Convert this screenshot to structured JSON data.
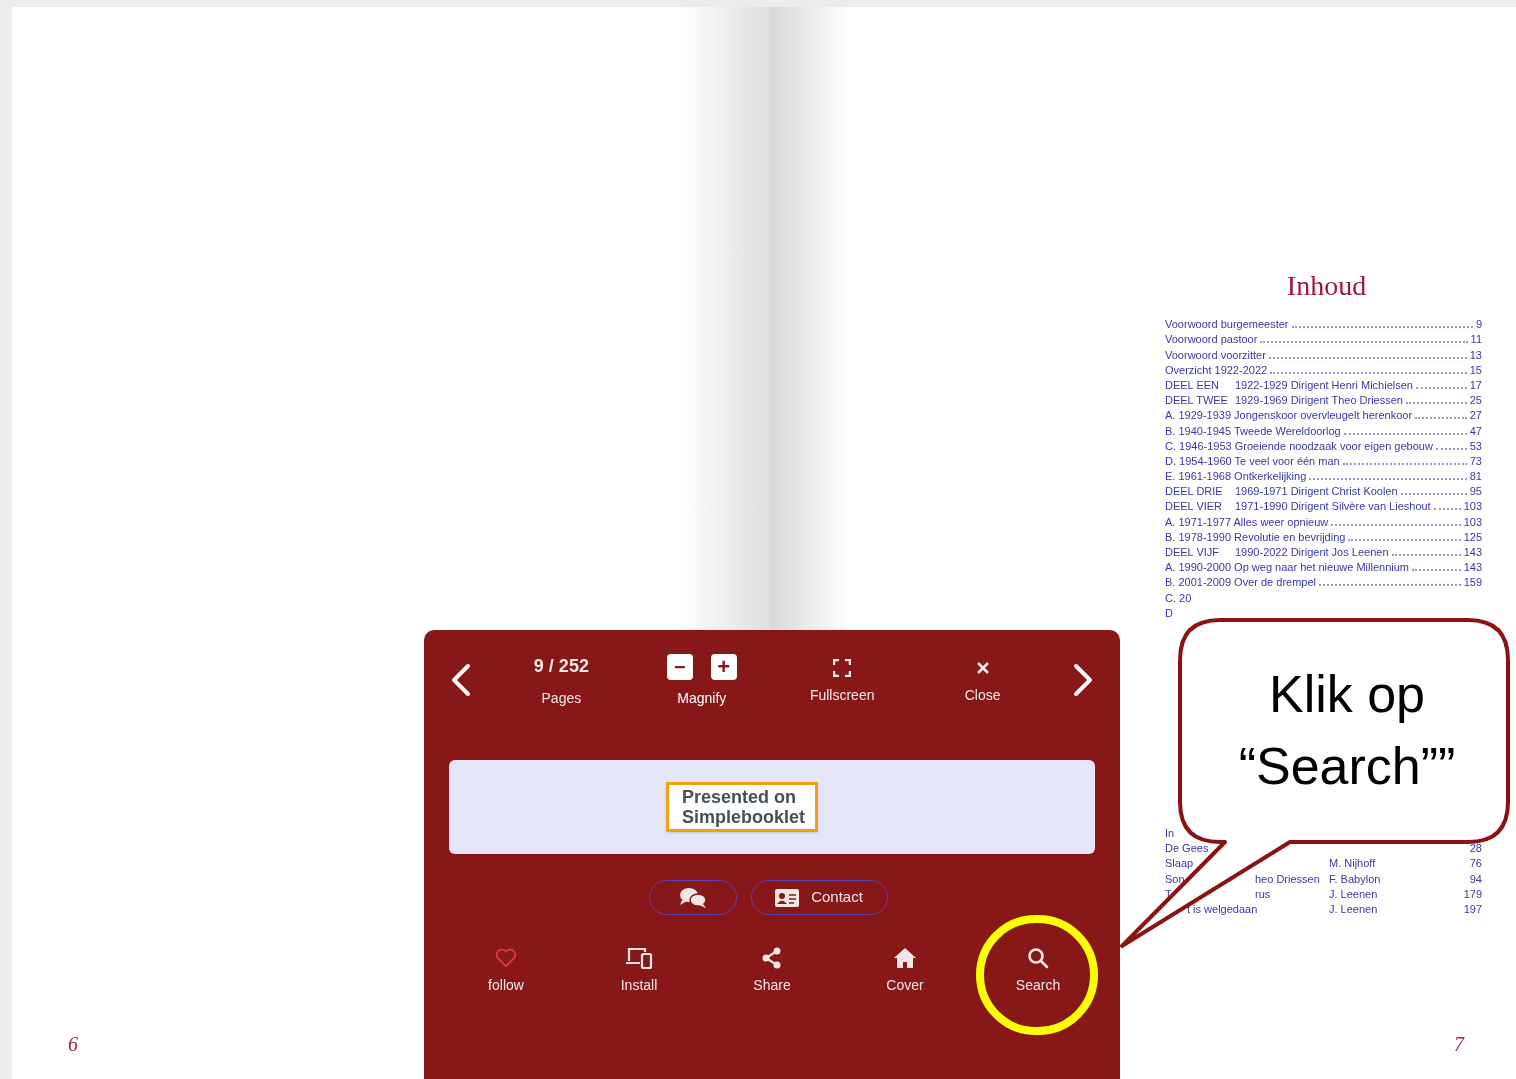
{
  "book": {
    "left_page_number": "6",
    "right_page_number": "7"
  },
  "toc": {
    "heading": "Inhoud",
    "entries": [
      {
        "title": "Voorwoord burgemeester",
        "page": "9"
      },
      {
        "title": "Voorwoord pastoor",
        "page": "11"
      },
      {
        "title": "Voorwoord voorzitter",
        "page": "13"
      },
      {
        "title": "Overzicht 1922-2022",
        "page": "15"
      },
      {
        "label": "DEEL EEN",
        "title": "1922-1929 Dirigent Henri Michielsen",
        "page": "17"
      },
      {
        "label": "DEEL TWEE",
        "title": "1929-1969 Dirigent Theo Driessen",
        "page": "25"
      },
      {
        "title": "A. 1929-1939 Jongenskoor overvleugelt herenkoor",
        "page": "27"
      },
      {
        "title": "B. 1940-1945 Tweede Wereldoorlog",
        "page": "47"
      },
      {
        "title": "C. 1946-1953 Groeiende noodzaak voor eigen gebouw",
        "page": "53"
      },
      {
        "title": "D. 1954-1960 Te veel voor één man",
        "page": "73"
      },
      {
        "title": "E. 1961-1968 Ontkerkelijking",
        "page": "81"
      },
      {
        "label": "DEEL DRIE",
        "title": "1969-1971 Dirigent Christ Koolen",
        "page": "95"
      },
      {
        "label": "DEEL VIER",
        "title": "1971-1990 Dirigent Silvère van Lieshout",
        "page": "103"
      },
      {
        "title": "A. 1971-1977 Alles weer opnieuw",
        "page": "103"
      },
      {
        "title": "B. 1978-1990 Revolutie en bevrijding",
        "page": "125"
      },
      {
        "label": "DEEL VIJF",
        "title": "1990-2022 Dirigent Jos Leenen",
        "page": "143"
      },
      {
        "title": "A. 1990-2000 Op weg naar het nieuwe Millennium",
        "page": "143"
      },
      {
        "title": "B. 2001-2009 Over de drempel",
        "page": "159"
      },
      {
        "title": "C. 20"
      },
      {
        "title": "D"
      }
    ],
    "lower_entries": [
      {
        "title": "In"
      },
      {
        "title": "De Gees",
        "page": "28"
      },
      {
        "title": "Slaap",
        "author": "M. Nijhoff",
        "page": "76"
      },
      {
        "title": "Son",
        "tail": "heo Driessen",
        "author": "F. Babylon",
        "page": "94"
      },
      {
        "title": "T",
        "tail": "rus",
        "author": "J. Leenen",
        "page": "179"
      },
      {
        "title": "t is welgedaan",
        "author": "J. Leenen",
        "page": "197"
      }
    ]
  },
  "viewer_panel": {
    "top_controls": [
      {
        "kind": "prev"
      },
      {
        "kind": "pages",
        "value": "9 / 252",
        "label": "Pages"
      },
      {
        "kind": "magnify",
        "minus": "−",
        "plus": "+",
        "label": "Magnify"
      },
      {
        "kind": "fullscreen",
        "label": "Fullscreen"
      },
      {
        "kind": "close",
        "label": "Close"
      },
      {
        "kind": "next"
      }
    ],
    "banner": {
      "badge_text": "Presented on Simplebooklet"
    },
    "pill_buttons": [
      {
        "kind": "chat"
      },
      {
        "kind": "contact",
        "label": "Contact"
      }
    ],
    "bottom_actions": [
      {
        "kind": "follow",
        "label": "follow",
        "highlighted": false
      },
      {
        "kind": "install",
        "label": "Install",
        "highlighted": false
      },
      {
        "kind": "share",
        "label": "Share",
        "highlighted": false
      },
      {
        "kind": "cover",
        "label": "Cover",
        "highlighted": false
      },
      {
        "kind": "search",
        "label": "Search",
        "highlighted": true
      }
    ]
  },
  "callout": {
    "text": "Klik op “Search””"
  }
}
